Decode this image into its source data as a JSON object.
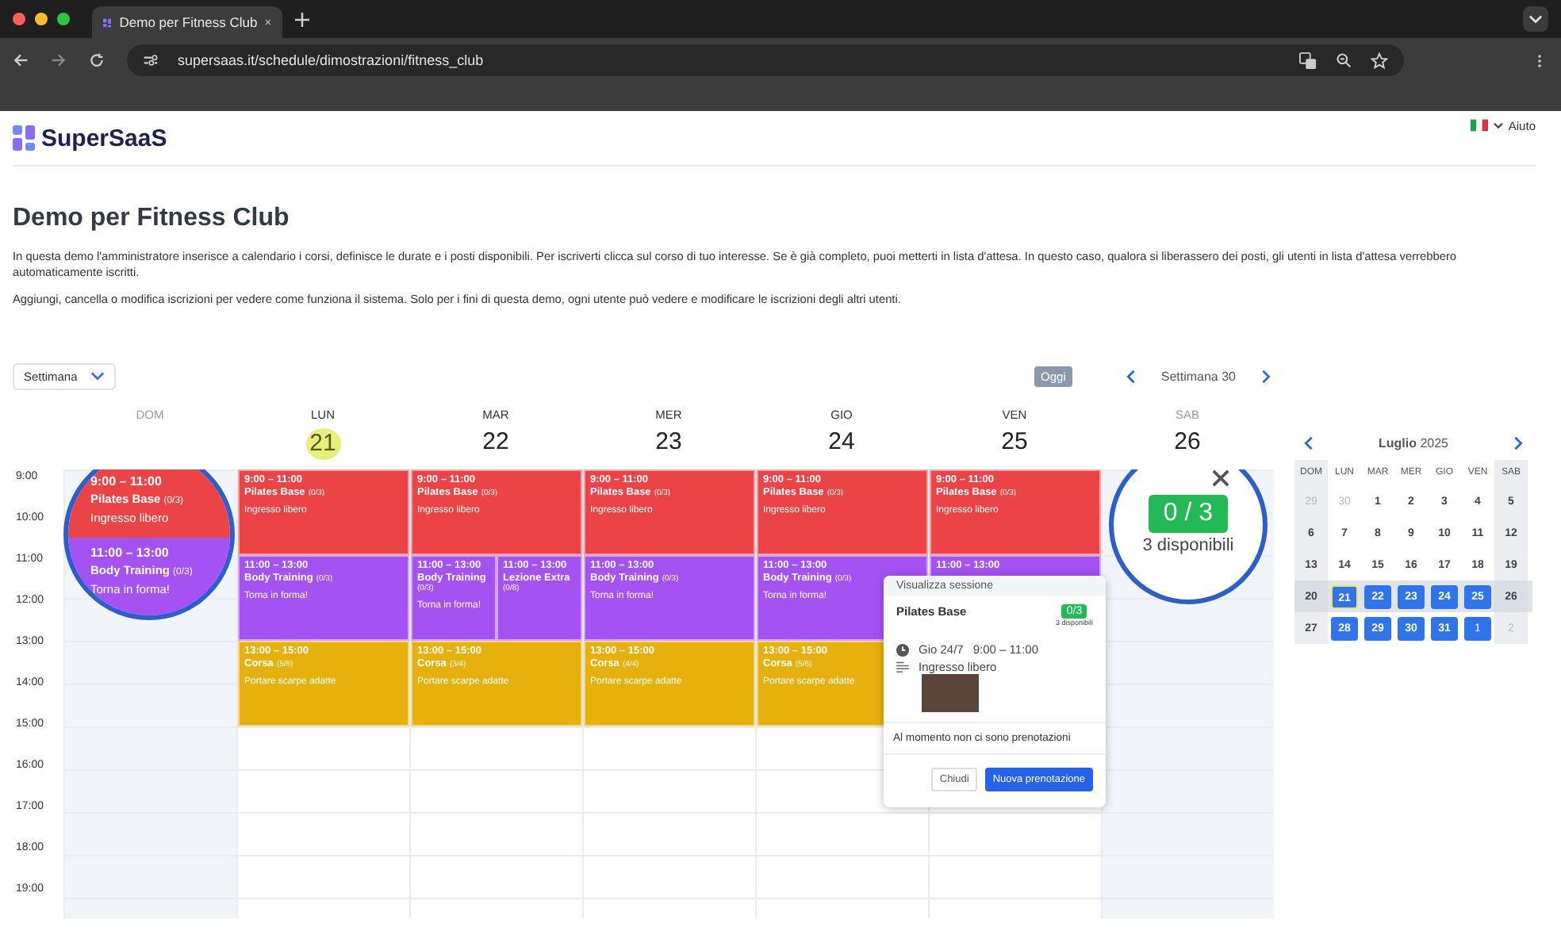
{
  "browser": {
    "tab_title": "Demo per Fitness Club",
    "url": "supersaas.it/schedule/dimostrazioni/fitness_club"
  },
  "header": {
    "logo": "SuperSaaS",
    "help": "Aiuto"
  },
  "page": {
    "title": "Demo per Fitness Club",
    "paragraphs": [
      "In questa demo l'amministratore inserisce a calendario i corsi, definisce le durate e i posti disponibili. Per iscriverti clicca sul corso di tuo interesse. Se è già completo, puoi metterti in lista d'attesa. In questo caso, qualora si liberassero dei posti, gli utenti in lista d'attesa verrebbero automaticamente iscritti.",
      "Aggiungi, cancella o modifica iscrizioni per vedere come funziona il sistema. Solo per i fini di questa demo, ogni utente può vedere e modificare le iscrizioni degli altri utenti."
    ]
  },
  "toolbar": {
    "view": "Settimana",
    "today": "Oggi",
    "week": "Settimana 30"
  },
  "calendar": {
    "hours": [
      "9:00",
      "10:00",
      "11:00",
      "12:00",
      "13:00",
      "14:00",
      "15:00",
      "16:00",
      "17:00",
      "18:00",
      "19:00"
    ],
    "days": [
      {
        "weekday": "DOM",
        "weekend": true
      },
      {
        "weekday": "LUN",
        "date": "21",
        "today": true,
        "weekend": false,
        "events": [
          {
            "kind": "morning",
            "color": "#ec4346",
            "time": "9:00 – 11:00",
            "title": "Pilates Base",
            "count": "(0/3)",
            "note": "Ingresso libero"
          },
          {
            "kind": "midday",
            "color": "#a452f2",
            "time": "11:00 – 13:00",
            "title": "Body Training",
            "count": "(0/3)",
            "note": "Torna in forma!"
          },
          {
            "kind": "afternoon",
            "color": "#e6b10c",
            "time": "13:00 – 15:00",
            "title": "Corsa",
            "count": "(5/6)",
            "note": "Portare scarpe adatte"
          }
        ]
      },
      {
        "weekday": "MAR",
        "date": "22",
        "today": false,
        "weekend": false,
        "events": [
          {
            "kind": "morning",
            "color": "#ec4346",
            "time": "9:00 – 11:00",
            "title": "Pilates Base",
            "count": "(0/3)",
            "note": "Ingresso libero"
          },
          {
            "kind": "midday",
            "color": "#a452f2",
            "time": "11:00 – 13:00",
            "title": "Body Training",
            "count": "(0/3)",
            "note": "Torna in forma!"
          },
          {
            "kind": "midday",
            "color": "#a452f2",
            "time": "11:00 – 13:00",
            "title": "Lezione Extra",
            "count": "(0/8)"
          },
          {
            "kind": "afternoon",
            "color": "#e6b10c",
            "time": "13:00 – 15:00",
            "title": "Corsa",
            "count": "(3/4)",
            "note": "Portare scarpe adatte"
          }
        ]
      },
      {
        "weekday": "MER",
        "date": "23",
        "today": false,
        "weekend": false,
        "events": [
          {
            "kind": "morning",
            "color": "#ec4346",
            "time": "9:00 – 11:00",
            "title": "Pilates Base",
            "count": "(0/3)",
            "note": "Ingresso libero"
          },
          {
            "kind": "midday",
            "color": "#a452f2",
            "time": "11:00 – 13:00",
            "title": "Body Training",
            "count": "(0/3)",
            "note": "Torna in forma!"
          },
          {
            "kind": "afternoon",
            "color": "#e6b10c",
            "time": "13:00 – 15:00",
            "title": "Corsa",
            "count": "(4/4)",
            "note": "Portare scarpe adatte"
          }
        ]
      },
      {
        "weekday": "GIO",
        "date": "24",
        "today": false,
        "weekend": false,
        "events": [
          {
            "kind": "morning",
            "color": "#ec4346",
            "time": "9:00 – 11:00",
            "title": "Pilates Base",
            "count": "(0/3)",
            "note": "Ingresso libero"
          },
          {
            "kind": "midday",
            "color": "#a452f2",
            "time": "11:00 – 13:00",
            "title": "Body Training",
            "count": "(0/3)",
            "note": "Torna in forma!"
          },
          {
            "kind": "afternoon",
            "color": "#e6b10c",
            "time": "13:00 – 15:00",
            "title": "Corsa",
            "count": "(5/6)",
            "note": "Portare scarpe adatte"
          }
        ]
      },
      {
        "weekday": "VEN",
        "date": "25",
        "today": false,
        "weekend": false,
        "events": [
          {
            "kind": "morning",
            "color": "#ec4346",
            "time": "9:00 – 11:00",
            "title": "Pilates Base",
            "count": "(0/3)",
            "note": "Ingresso libero"
          },
          {
            "kind": "midday",
            "color": "#a452f2",
            "time": "11:00 – 13:00"
          }
        ]
      },
      {
        "weekday": "SAB",
        "date": "26",
        "today": false,
        "weekend": true
      }
    ]
  },
  "magnifiers": [
    {
      "kind": "events",
      "events": [
        {
          "color": "#ec4346",
          "time": "9:00 – 11:00",
          "title": "Pilates Base",
          "count": "(0/3)",
          "note": "Ingresso libero"
        },
        {
          "color": "#a452f2",
          "time": "11:00 – 13:00",
          "title": "Body Training",
          "count": "(0/3)",
          "note": "Torna in forma!"
        }
      ]
    },
    {
      "kind": "capacity",
      "badge": "0 / 3",
      "caption": "3 disponibili"
    }
  ],
  "popup": {
    "header": "Visualizza sessione",
    "title": "Pilates Base",
    "badge": "0/3",
    "availability": "3 disponibili",
    "date": "Gio 24/7",
    "time": "9:00 – 11:00",
    "description": "Ingresso libero",
    "empty_message": "Al momento non ci sono prenotazioni",
    "buttons": [
      {
        "label": "Chiudi",
        "kind": "secondary"
      },
      {
        "label": "Nuova prenotazione",
        "kind": "primary"
      }
    ]
  },
  "mini_calendar": {
    "month": "**Luglio** 2025",
    "weekdays": [
      "DOM",
      "LUN",
      "MAR",
      "MER",
      "GIO",
      "VEN",
      "SAB"
    ],
    "weeks": [
      {
        "selected": false,
        "days": [
          {
            "label": "29",
            "outside": true,
            "available": false,
            "today": false
          },
          {
            "label": "30",
            "outside": true,
            "available": false,
            "today": false
          },
          {
            "label": "1",
            "outside": false,
            "available": false,
            "today": false
          },
          {
            "label": "2",
            "outside": false,
            "available": false,
            "today": false
          },
          {
            "label": "3",
            "outside": false,
            "available": false,
            "today": false
          },
          {
            "label": "4",
            "outside": false,
            "available": false,
            "today": false
          },
          {
            "label": "5",
            "outside": false,
            "available": false,
            "today": false
          }
        ]
      },
      {
        "selected": false,
        "days": [
          {
            "label": "6",
            "outside": false,
            "available": false,
            "today": false
          },
          {
            "label": "7",
            "outside": false,
            "available": false,
            "today": false
          },
          {
            "label": "8",
            "outside": false,
            "available": false,
            "today": false
          },
          {
            "label": "9",
            "outside": false,
            "available": false,
            "today": false
          },
          {
            "label": "10",
            "outside": false,
            "available": false,
            "today": false
          },
          {
            "label": "11",
            "outside": false,
            "available": false,
            "today": false
          },
          {
            "label": "12",
            "outside": false,
            "available": false,
            "today": false
          }
        ]
      },
      {
        "selected": false,
        "days": [
          {
            "label": "13",
            "outside": false,
            "available": false,
            "today": false
          },
          {
            "label": "14",
            "outside": false,
            "available": false,
            "today": false
          },
          {
            "label": "15",
            "outside": false,
            "available": false,
            "today": false
          },
          {
            "label": "16",
            "outside": false,
            "available": false,
            "today": false
          },
          {
            "label": "17",
            "outside": false,
            "available": false,
            "today": false
          },
          {
            "label": "18",
            "outside": false,
            "available": false,
            "today": false
          },
          {
            "label": "19",
            "outside": false,
            "available": false,
            "today": false
          }
        ]
      },
      {
        "selected": true,
        "days": [
          {
            "label": "20",
            "outside": false,
            "available": false,
            "today": false
          },
          {
            "label": "21",
            "outside": false,
            "available": true,
            "today": true
          },
          {
            "label": "22",
            "outside": false,
            "available": true,
            "today": false
          },
          {
            "label": "23",
            "outside": false,
            "available": true,
            "today": false
          },
          {
            "label": "24",
            "outside": false,
            "available": true,
            "today": false
          },
          {
            "label": "25",
            "outside": false,
            "available": true,
            "today": false
          },
          {
            "label": "26",
            "outside": false,
            "available": false,
            "today": false
          }
        ]
      },
      {
        "selected": false,
        "days": [
          {
            "label": "27",
            "outside": false,
            "available": false,
            "today": false
          },
          {
            "label": "28",
            "outside": false,
            "available": true,
            "today": false
          },
          {
            "label": "29",
            "outside": false,
            "available": true,
            "today": false
          },
          {
            "label": "30",
            "outside": false,
            "available": true,
            "today": false
          },
          {
            "label": "31",
            "outside": false,
            "available": true,
            "today": false
          },
          {
            "label": "1",
            "outside": true,
            "available": true,
            "today": false
          },
          {
            "label": "2",
            "outside": true,
            "available": false,
            "today": false
          }
        ]
      }
    ]
  }
}
